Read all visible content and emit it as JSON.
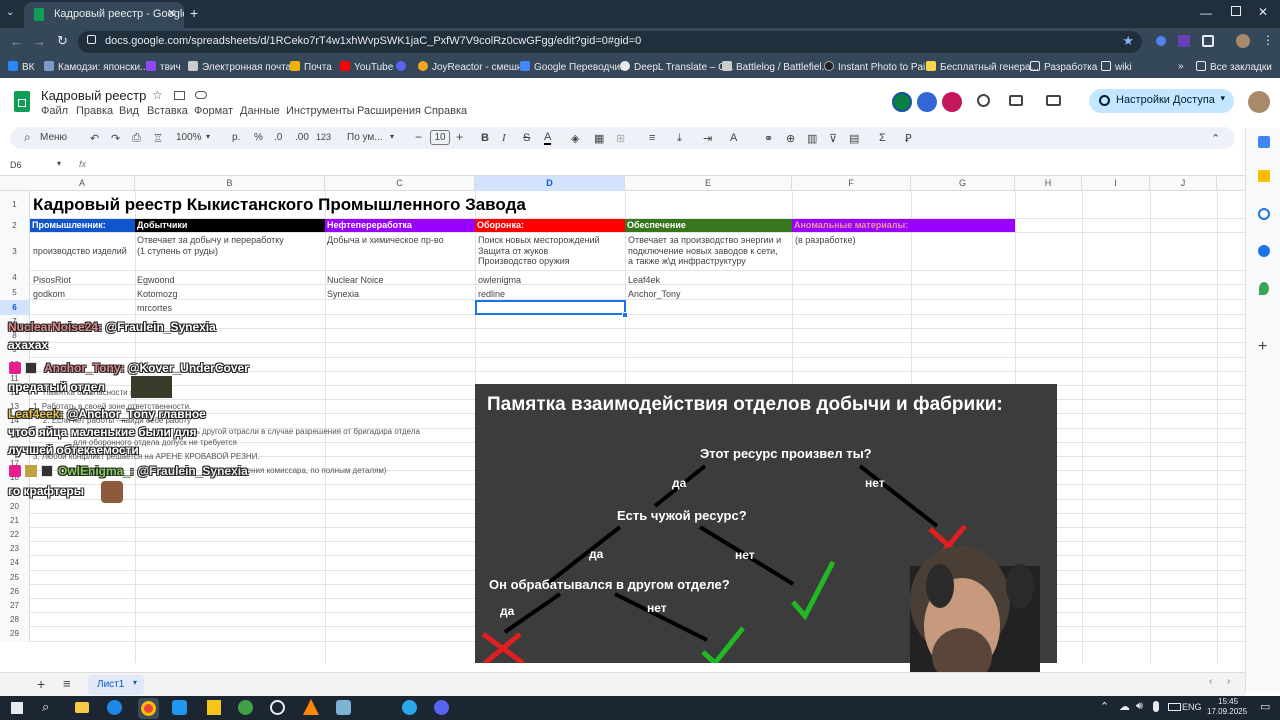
{
  "browser": {
    "tab_title": "Кадровый реестр - Google Та",
    "url": "docs.google.com/spreadsheets/d/1RCeko7rT4w1xhWvpSWK1jaC_PxfW7V9colRz0cwGFgg/edit?gid=0#gid=0",
    "bookmarks": [
      "ВК",
      "Камодзи: японски...",
      "твич",
      "Электронная почта...",
      "Почта",
      "YouTube",
      "JoyReactor - смешн...",
      "Google Переводчик",
      "DeepL Translate – С...",
      "Battlelog / Battlefiel...",
      "Instant Photo to Pai...",
      "Бесплатный генера...",
      "Разработка",
      "wiki",
      "Все закладки"
    ]
  },
  "doc": {
    "title": "Кадровый реестр",
    "menu": [
      "Файл",
      "Правка",
      "Вид",
      "Вставка",
      "Формат",
      "Данные",
      "Инструменты",
      "Расширения",
      "Справка"
    ],
    "share_label": "Настройки Доступа",
    "cell_ref": "D6",
    "fx": "fx"
  },
  "toolbar": {
    "menu": "Меню",
    "zoom": "100%",
    "currency": "р.",
    "percent": "%",
    "dec_minus": ".0",
    "dec_plus": ".00",
    "num_format": "123",
    "font": "По ум...",
    "font_size": "10"
  },
  "columns": [
    "A",
    "B",
    "C",
    "D",
    "E",
    "F",
    "G",
    "H",
    "I",
    "J"
  ],
  "rows": [
    "1",
    "2",
    "3",
    "4",
    "5",
    "6",
    "7",
    "8",
    "9",
    "10",
    "11",
    "12",
    "13",
    "14",
    "15",
    "16",
    "17",
    "18",
    "19",
    "20",
    "21",
    "22",
    "23",
    "24",
    "25",
    "26",
    "27",
    "28",
    "29"
  ],
  "sheet": {
    "title": "Кадровый реестр Кыкистанского Промышленного Завода",
    "headers": [
      "Промышленник:",
      "Добытчики",
      "Нефтепереработка",
      "Оборонка:",
      "Обеспечение",
      "Аномальные материалы:"
    ],
    "header_colors": [
      "#1155cc",
      "#000000",
      "#9900ff",
      "#ff0000",
      "#38761d",
      "#9900ff"
    ],
    "header_text_colors": [
      "#ffffff",
      "#ffffff",
      "#ffffff",
      "#ffffff",
      "#ffffff",
      "#ea9999"
    ],
    "row3": [
      "производство изделий",
      "Отвечает за добычу и переработку\n(1 ступень от руды)",
      "Добыча и химическое пр-во",
      "Поиск новых месторождений\nЗащита от жуков\nПроизводство оружия",
      "Отвечает за производство энергии и\nподключение новых заводов к сети,\nа также ж\\д инфраструктуру",
      "(в разработке)"
    ],
    "row4": [
      "PisosRiot",
      "Egwoond",
      "Nuclear Noice",
      "owlenigma",
      "Leaf4ek"
    ],
    "row5": [
      "godkom",
      "Kotomozg",
      "Synexia",
      "redline",
      "Anchor_Tony"
    ],
    "row6": [
      "",
      "mrcortes"
    ],
    "hidden_notes": [
      "Памятка безопасности          ятия:",
      "1. Работать в своей зоне ответственности.",
      "2. Если нет работы - найди себе работу",
      "3. Помощь другой отрасли в случае разрешения от бригадира отдела",
      "для оборонного отдела допуск не требуется",
      "3. Любой конфликт решается на АРЕНЕ КРОВАВОЙ РЕЗНИ.",
      "(с разрешения комиссара, по полным деталям)"
    ],
    "tab": "Лист1"
  },
  "chat": [
    {
      "user": "NuclearNoise24:",
      "text": "@Fraulein_Synexia",
      "line2": "ахахах"
    },
    {
      "user": "Anchor_Tony:",
      "text": "@Kover_UnderCover",
      "line2": "предатый отдел"
    },
    {
      "user": "Leaf4eek:",
      "text": "@Anchor_Tony главное",
      "line2": "чтоб яйца маленькие были для",
      "line3": "лучшей обтекаемости"
    },
    {
      "user": "OwlEnigma_:",
      "text": "@Fraulein_Synexia",
      "line2": "го крафтеры"
    }
  ],
  "memo": {
    "title": "Памятка взаимодействия отделов добычи и фабрики:",
    "q1": "Этот ресурс произвел ты?",
    "q2": "Есть чужой ресурс?",
    "q3": "Он обрабатывался в другом отделе?",
    "yes": "да",
    "no": "нет"
  },
  "taskbar": {
    "lang": "ENG",
    "time": "15:45",
    "date": "17.09.2025"
  }
}
